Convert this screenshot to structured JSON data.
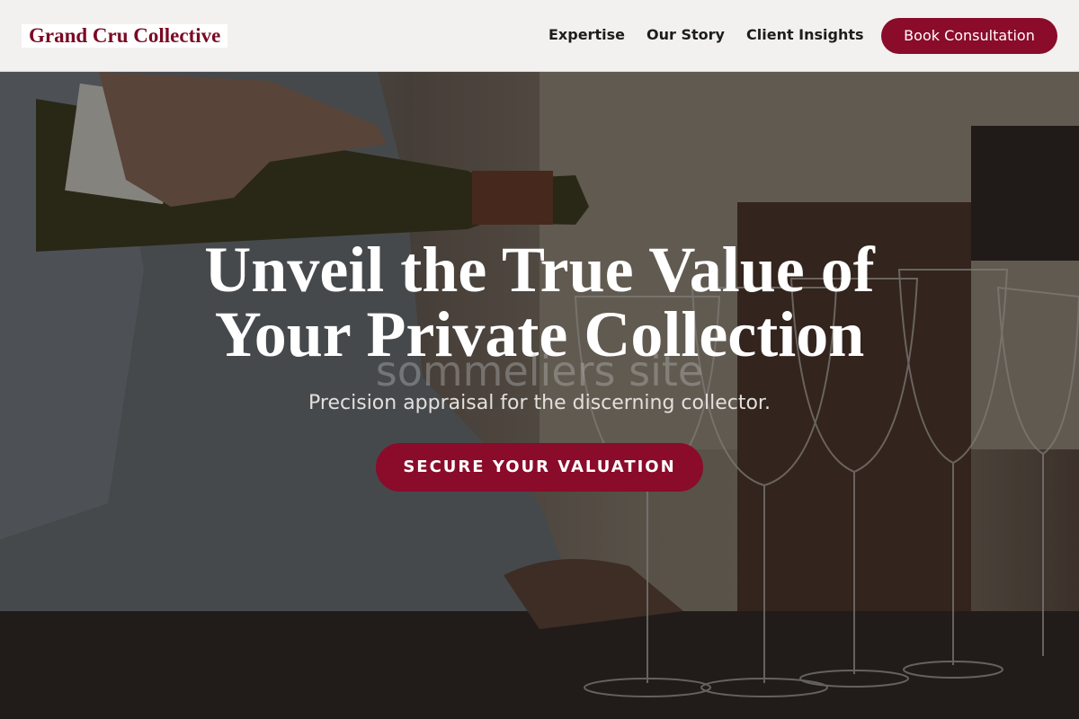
{
  "brand": {
    "name": "Grand Cru Collective",
    "accent": "#8a0b2a"
  },
  "nav": {
    "items": [
      {
        "label": "Expertise"
      },
      {
        "label": "Our Story"
      },
      {
        "label": "Client Insights"
      }
    ],
    "cta_label": "Book Consultation"
  },
  "hero": {
    "headline_line1": "Unveil the True Value of",
    "headline_line2": "Your Private Collection",
    "watermark": "sommeliers site",
    "subheadline": "Precision appraisal for the discerning collector.",
    "cta_label": "SECURE YOUR VALUATION",
    "image_subject": "wine-pouring-photo"
  }
}
